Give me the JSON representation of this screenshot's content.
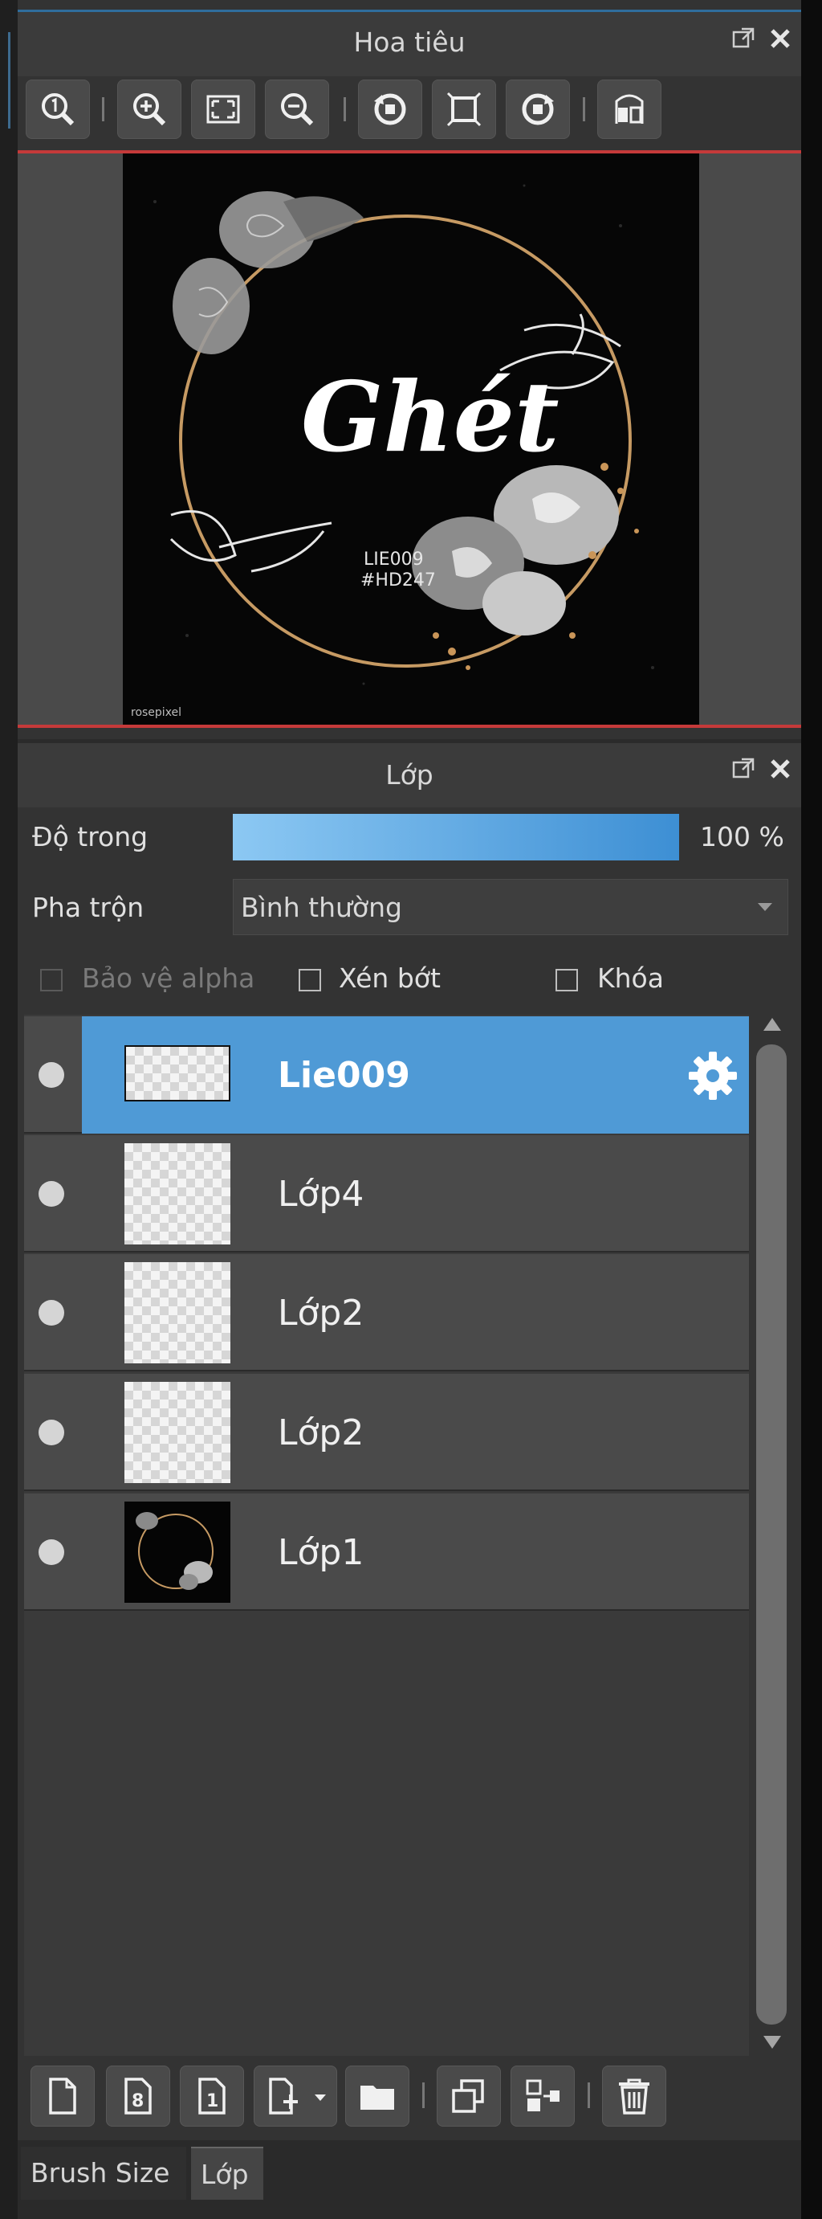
{
  "navigator": {
    "title": "Hoa tiêu",
    "toolbar": [
      "zoom-actual-icon",
      "zoom-in-icon",
      "fit-screen-icon",
      "zoom-out-icon",
      "rotate-left-icon",
      "fit-window-icon",
      "rotate-right-icon",
      "flip-horizontal-icon"
    ],
    "artwork": {
      "headline": "Ghét",
      "line1": "LIE009",
      "line2": "#HD247",
      "watermark": "rosepixel"
    }
  },
  "layers": {
    "title": "Lớp",
    "opacity_label": "Độ trong",
    "opacity_percent": 100,
    "opacity_text": "100 %",
    "blend_label": "Pha trộn",
    "blend_value": "Bình thường",
    "checkboxes": {
      "protect_alpha": "Bảo vệ alpha",
      "clipping": "Xén bớt",
      "lock": "Khóa"
    },
    "items": [
      {
        "name": "Lie009",
        "selected": true,
        "thumb": "transparent-wide"
      },
      {
        "name": "Lớp4",
        "selected": false,
        "thumb": "transparent"
      },
      {
        "name": "Lớp2",
        "selected": false,
        "thumb": "transparent"
      },
      {
        "name": "Lớp2",
        "selected": false,
        "thumb": "transparent"
      },
      {
        "name": "Lớp1",
        "selected": false,
        "thumb": "artwork"
      }
    ],
    "bottom_toolbar": [
      "new-layer-icon",
      "new-8bit-layer-icon",
      "new-1bit-layer-icon",
      "add-layer-menu-icon",
      "folder-icon",
      "duplicate-layer-icon",
      "merge-down-icon",
      "delete-icon"
    ]
  },
  "tabs": {
    "brush_size": "Brush Size",
    "layer": "Lớp"
  },
  "colors": {
    "accent": "#4f9ad6",
    "panel": "#333333",
    "header": "#3b3b3b",
    "preview_border": "#c53a3a"
  }
}
